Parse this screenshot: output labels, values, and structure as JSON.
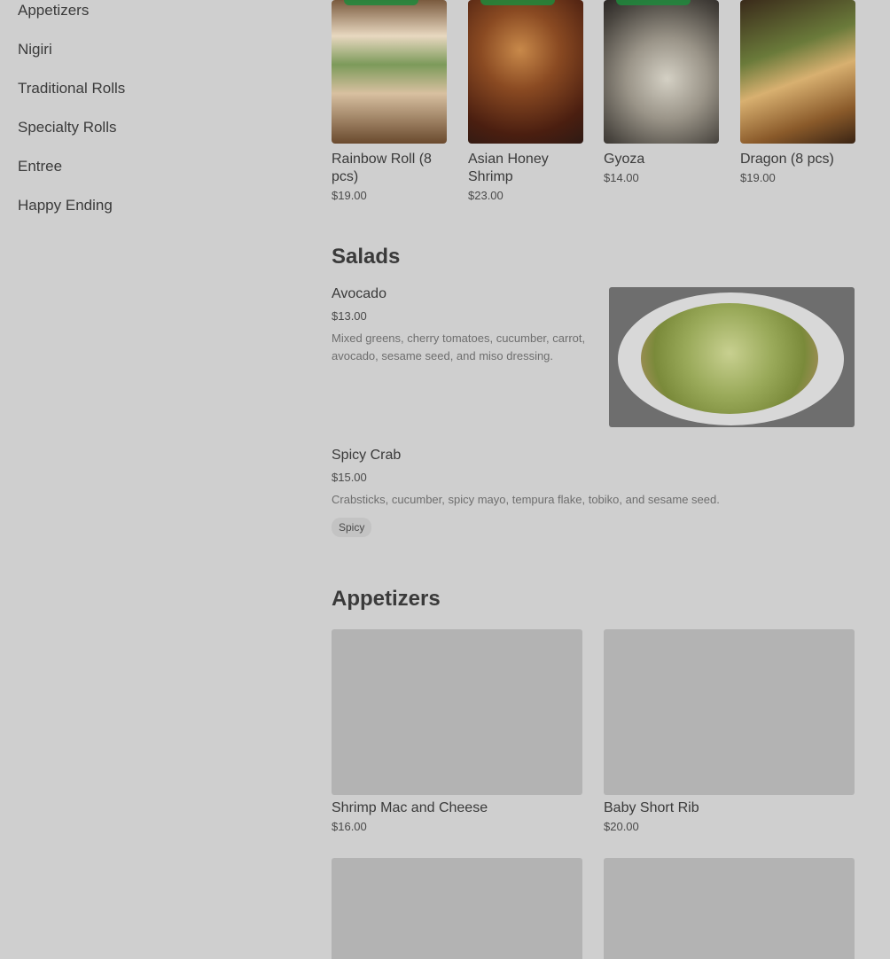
{
  "sidebar": {
    "items": [
      {
        "label": "Appetizers"
      },
      {
        "label": "Nigiri"
      },
      {
        "label": "Traditional Rolls"
      },
      {
        "label": "Specialty Rolls"
      },
      {
        "label": "Entree"
      },
      {
        "label": "Happy Ending"
      }
    ]
  },
  "featured": [
    {
      "name": "Rainbow Roll (8 pcs)",
      "price": "$19.00"
    },
    {
      "name": "Asian Honey Shrimp",
      "price": "$23.00"
    },
    {
      "name": "Gyoza",
      "price": "$14.00"
    },
    {
      "name": "Dragon (8 pcs)",
      "price": "$19.00"
    }
  ],
  "salads": {
    "title": "Salads",
    "items": [
      {
        "name": "Avocado",
        "price": "$13.00",
        "description": "Mixed greens, cherry tomatoes, cucumber, carrot, avocado, sesame seed, and miso dressing."
      },
      {
        "name": "Spicy Crab",
        "price": "$15.00",
        "description": "Crabsticks, cucumber, spicy mayo, tempura flake, tobiko, and sesame seed.",
        "tag": "Spicy"
      }
    ]
  },
  "appetizers": {
    "title": "Appetizers",
    "items": [
      {
        "name": "Shrimp Mac and Cheese",
        "price": "$16.00"
      },
      {
        "name": "Baby Short Rib",
        "price": "$20.00"
      }
    ]
  }
}
